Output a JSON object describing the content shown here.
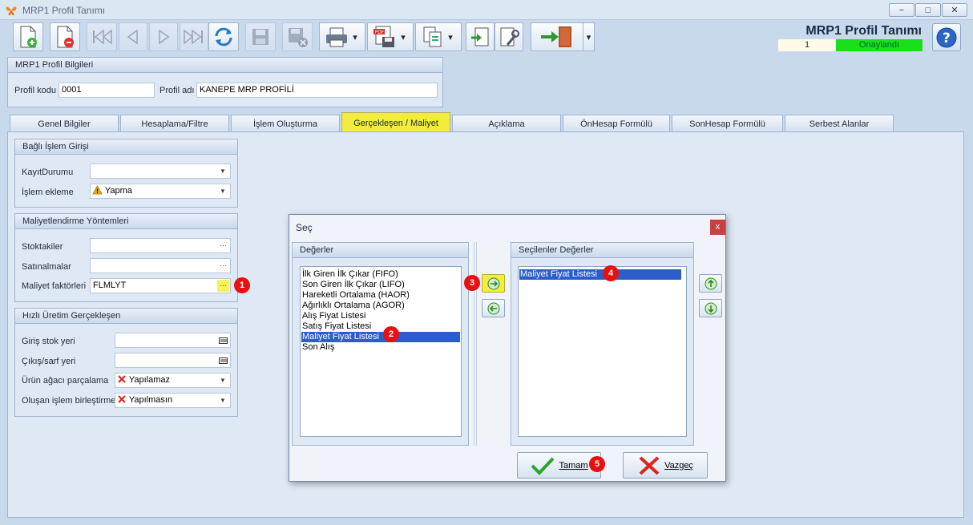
{
  "window": {
    "title": "MRP1 Profil Tanımı",
    "minimize": "−",
    "maximize": "□",
    "close": "✕"
  },
  "header": {
    "title": "MRP1 Profil Tanımı",
    "record_no": "1",
    "status": "Onaylandı",
    "status_color": "#19e019"
  },
  "toolbar": {
    "icons": [
      "new-document-icon",
      "delete-document-icon",
      "first-record-icon",
      "previous-record-icon",
      "next-record-icon",
      "last-record-icon",
      "refresh-icon",
      "save-icon",
      "save-cancel-icon",
      "print-icon",
      "pdf-export-icon",
      "copy-icon",
      "import-icon",
      "settings-icon",
      "exit-icon"
    ]
  },
  "profile_info": {
    "title": "MRP1 Profil Bilgileri",
    "code_label": "Profil kodu",
    "code_value": "0001",
    "name_label": "Profil adı",
    "name_value": "KANEPE MRP PROFİLİ"
  },
  "tabs": [
    {
      "label": "Genel Bilgiler"
    },
    {
      "label": "Hesaplama/Filtre"
    },
    {
      "label": "İşlem Oluşturma"
    },
    {
      "label": "Gerçekleşen / Maliyet"
    },
    {
      "label": "Açıklama"
    },
    {
      "label": "ÖnHesap Formülü"
    },
    {
      "label": "SonHesap Formülü"
    },
    {
      "label": "Serbest Alanlar"
    }
  ],
  "linked_ops": {
    "title": "Bağlı İşlem Girişi",
    "record_status_label": "KayıtDurumu",
    "record_status_value": "",
    "add_op_label": "İşlem ekleme",
    "add_op_value": "Yapma"
  },
  "costing": {
    "title": "Maliyetlendirme Yöntemleri",
    "stocktakes_label": "Stoktakiler",
    "stocktakes_value": "",
    "purchases_label": "Satınalmalar",
    "purchases_value": "",
    "factors_label": "Maliyet faktörleri",
    "factors_value": "FLMLYT",
    "ellipsis": "···"
  },
  "fast_prod": {
    "title": "Hızlı Üretim Gerçekleşen",
    "entry_stock_label": "Giriş stok yeri",
    "entry_stock_value": "",
    "exit_stock_label": "Çıkış/sarf yeri",
    "exit_stock_value": "",
    "bom_split_label": "Ürün ağacı parçalama",
    "bom_split_value": "Yapılamaz",
    "merge_label": "Oluşan işlem birleştirme",
    "merge_value": "Yapılmasın"
  },
  "dialog": {
    "title": "Seç",
    "close": "x",
    "values_title": "Değerler",
    "values": [
      "İlk Giren İlk Çıkar (FIFO)",
      "Son Giren İlk Çıkar (LIFO)",
      "Hareketli Ortalama (HAOR)",
      "Ağırlıklı Ortalama (AGOR)",
      "Alış Fiyat Listesi",
      "Satış Fiyat Listesi",
      "Maliyet Fiyat Listesi",
      "Son Alış"
    ],
    "selected_index": 6,
    "selected_title": "Seçilenler Değerler",
    "selected_values": [
      "Maliyet Fiyat Listesi"
    ],
    "ok_label": "Tamam",
    "cancel_label": "Vazgeç"
  },
  "badges": [
    "1",
    "2",
    "3",
    "4",
    "5"
  ]
}
